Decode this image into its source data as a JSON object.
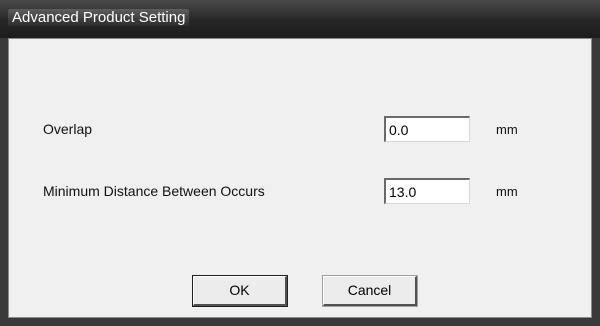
{
  "window": {
    "title": "Advanced Product Setting"
  },
  "fields": {
    "overlap": {
      "label": "Overlap",
      "value": "0.0",
      "unit": "mm"
    },
    "min_distance": {
      "label": "Minimum Distance Between Occurs",
      "value": "13.0",
      "unit": "mm"
    }
  },
  "buttons": {
    "ok_label": "OK",
    "cancel_label": "Cancel"
  },
  "colors": {
    "titlebar": "#262626",
    "dialog_background": "#f0f0f0"
  }
}
